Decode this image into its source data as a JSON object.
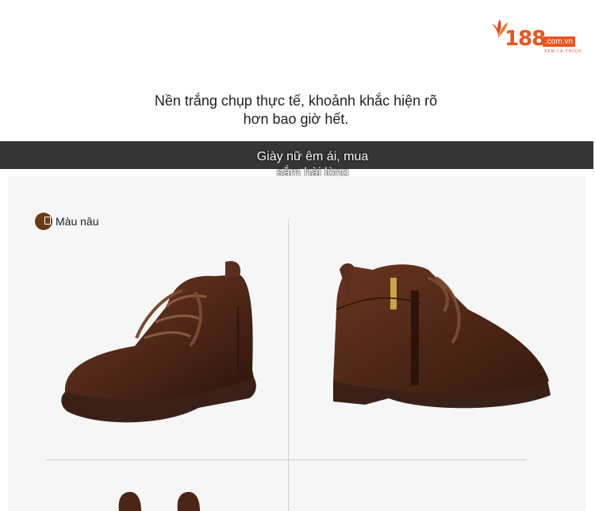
{
  "logo": {
    "number": "188",
    "domain": ".com.vn",
    "tagline": "XEM LÀ THÍCH",
    "color": "#e8541e"
  },
  "headline": {
    "line1": "Nền trắng chụp thực tế, khoảnh khắc hiện rõ",
    "line2": "hơn bao giờ hết."
  },
  "banner": {
    "line1": "Giày nữ êm ái, mua",
    "line2": "sắm hài lòng"
  },
  "product": {
    "color_label": "Màu nâu",
    "color_swatch": "#6b3a16"
  }
}
